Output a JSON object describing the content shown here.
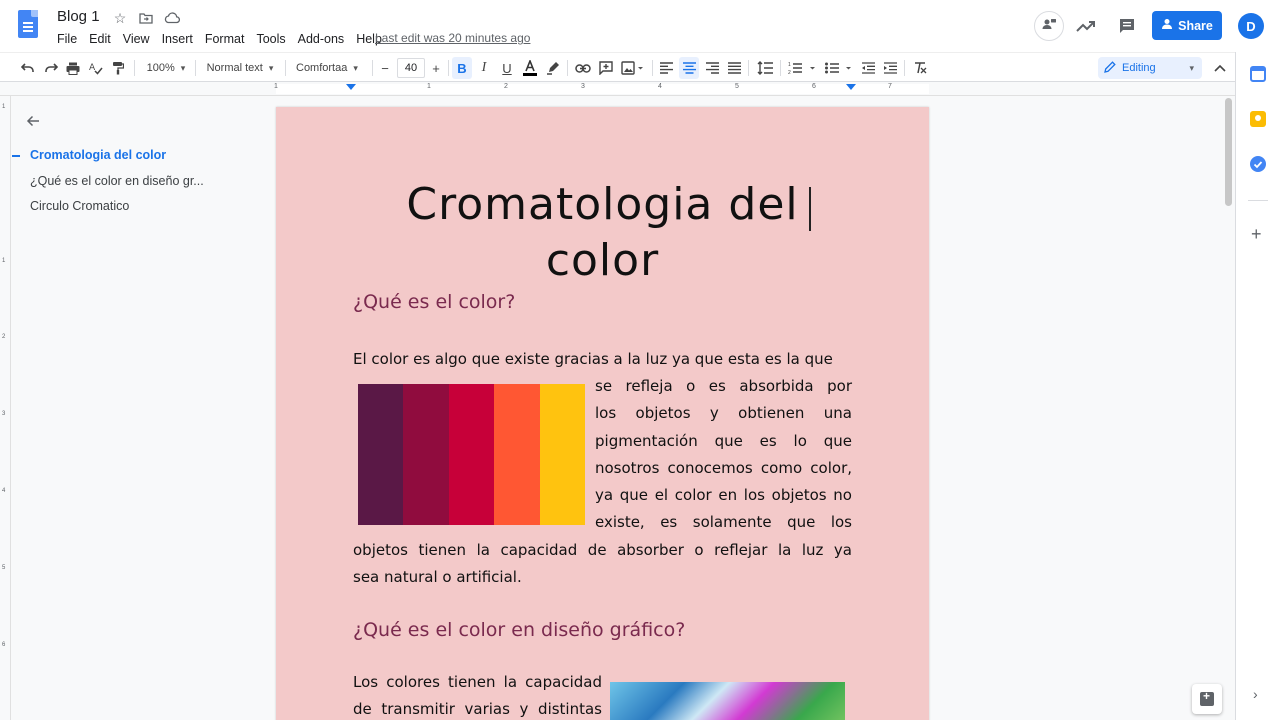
{
  "header": {
    "doc_title": "Blog 1",
    "menu": [
      "File",
      "Edit",
      "View",
      "Insert",
      "Format",
      "Tools",
      "Add-ons",
      "Help"
    ],
    "last_edit": "Last edit was 20 minutes ago",
    "share_label": "Share",
    "avatar_initial": "D"
  },
  "toolbar": {
    "zoom": "100%",
    "style": "Normal text",
    "font": "Comfortaa",
    "font_size": "40",
    "mode": "Editing"
  },
  "ruler": {
    "numbers": [
      "1",
      "1",
      "2",
      "3",
      "4",
      "5",
      "6",
      "7"
    ]
  },
  "vruler": {
    "numbers": [
      "1",
      "1",
      "2",
      "3",
      "4",
      "5",
      "6"
    ]
  },
  "outline": {
    "items": [
      {
        "label": "Cromatologia del color"
      },
      {
        "label": "¿Qué es el color en diseño gr..."
      },
      {
        "label": "Circulo Cromatico"
      }
    ]
  },
  "document": {
    "title_line1": "Cromatologia del",
    "title_line2": "color",
    "h2_1": "¿Qué es el color?",
    "p1_lines": [
      "El color es algo que existe gracias a la luz ya que esta es la que",
      "se refleja o es absorbida por",
      "los objetos y obtienen una",
      "pigmentación que es lo que",
      "nosotros conocemos como color,",
      "ya que el color en los objetos no",
      "existe, es solamente que los",
      "objetos tienen la capacidad de absorber o reflejar la luz ya",
      "sea natural o artificial."
    ],
    "h2_2": "¿Qué es el color en diseño gráfico?",
    "p2_lines": [
      "Los colores tienen la capacidad",
      "de transmitir varias y distintas"
    ],
    "palette": [
      "#5a1846",
      "#900c3e",
      "#c70039",
      "#ff5733",
      "#ffc30f"
    ]
  },
  "colors": {
    "accent": "#1a73e8",
    "page_bg": "#f3c9c9",
    "heading2": "#7a2a4e"
  }
}
